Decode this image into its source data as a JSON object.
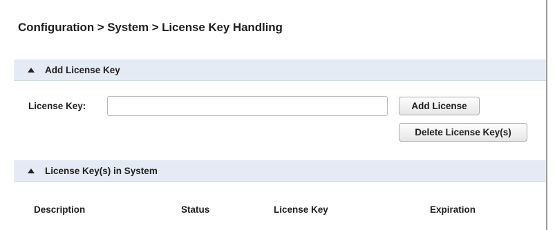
{
  "breadcrumb": "Configuration > System > License Key Handling",
  "add_section": {
    "title": "Add License Key",
    "field_label": "License Key:",
    "input_value": "",
    "add_button": "Add License",
    "delete_button": "Delete License Key(s)"
  },
  "keys_section": {
    "title": "License Key(s) in System",
    "columns": [
      "Description",
      "Status",
      "License Key",
      "Expiration"
    ]
  },
  "icons": {
    "section_toggle": "collapse-triangle-icon"
  }
}
